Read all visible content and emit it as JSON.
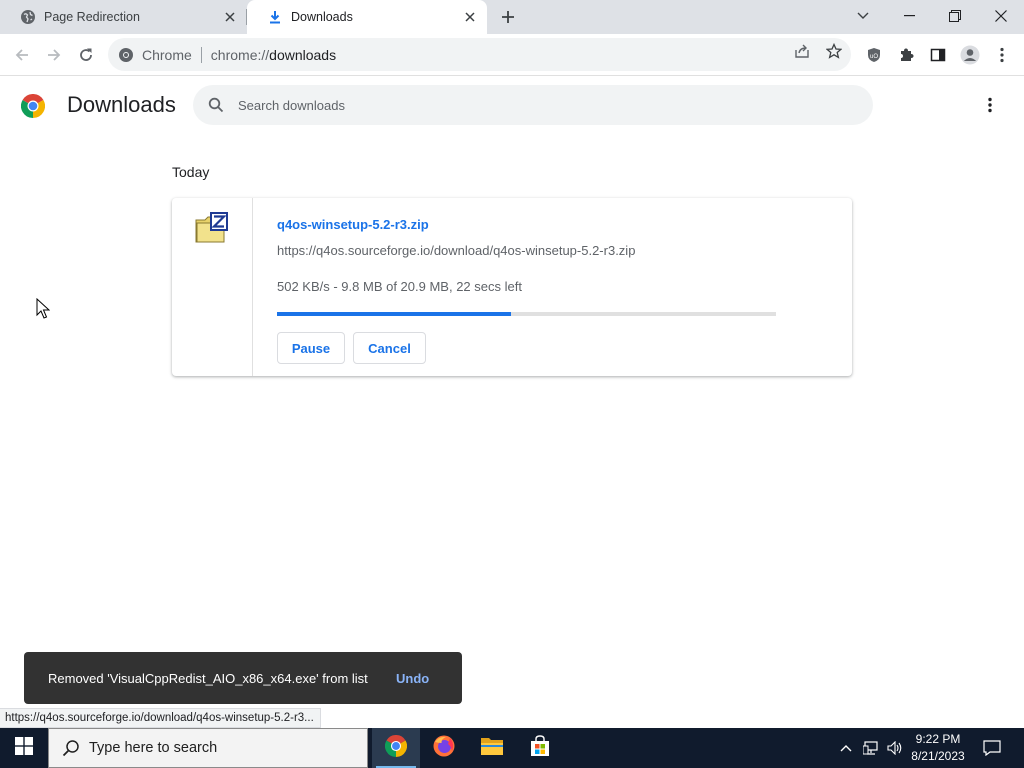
{
  "tabs": [
    {
      "title": "Page Redirection",
      "icon": "globe-icon",
      "active": false
    },
    {
      "title": "Downloads",
      "icon": "download-icon",
      "active": true
    }
  ],
  "window_controls": [
    "tab-search-chevron",
    "minimize",
    "restore",
    "close"
  ],
  "toolbar": {
    "site_name": "Chrome",
    "url_scheme": "chrome://",
    "url_path": "downloads"
  },
  "downloads_page": {
    "title": "Downloads",
    "search_placeholder": "Search downloads",
    "date_group": "Today",
    "items": [
      {
        "file_name": "q4os-winsetup-5.2-r3.zip",
        "url": "https://q4os.sourceforge.io/download/q4os-winsetup-5.2-r3.zip",
        "status": "502 KB/s - 9.8 MB of 20.9 MB, 22 secs left",
        "progress_fraction": 0.469,
        "pause_label": "Pause",
        "cancel_label": "Cancel"
      }
    ]
  },
  "toast": {
    "message": "Removed 'VisualCppRedist_AIO_x86_x64.exe' from list",
    "undo_label": "Undo"
  },
  "status_bubble": "https://q4os.sourceforge.io/download/q4os-winsetup-5.2-r3...",
  "taskbar": {
    "search_placeholder": "Type here to search",
    "apps": [
      "chrome-icon",
      "firefox-icon",
      "file-explorer-icon",
      "store-icon"
    ],
    "time": "9:22 PM",
    "date": "8/21/2023"
  },
  "colors": {
    "accent": "#1a73e8",
    "tabstrip": "#dee1e6",
    "taskbar": "#101b2d",
    "toast_bg": "#323232",
    "undo_link": "#8ab4f8"
  }
}
